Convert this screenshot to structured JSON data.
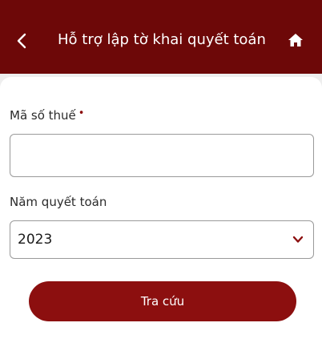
{
  "header": {
    "title": "Hỗ trợ lập tờ khai quyết toán",
    "back_icon": "chevron-left-icon",
    "home_icon": "home-icon",
    "background": "#6d0808"
  },
  "form": {
    "tax_code": {
      "label": "Mã số thuế",
      "required_marker": "•",
      "value": ""
    },
    "settlement_year": {
      "label": "Năm quyết toán",
      "selected": "2023",
      "dropdown_icon": "chevron-down-icon"
    },
    "submit_label": "Tra cứu"
  },
  "colors": {
    "accent": "#8c0f0f",
    "header": "#6d0808"
  }
}
